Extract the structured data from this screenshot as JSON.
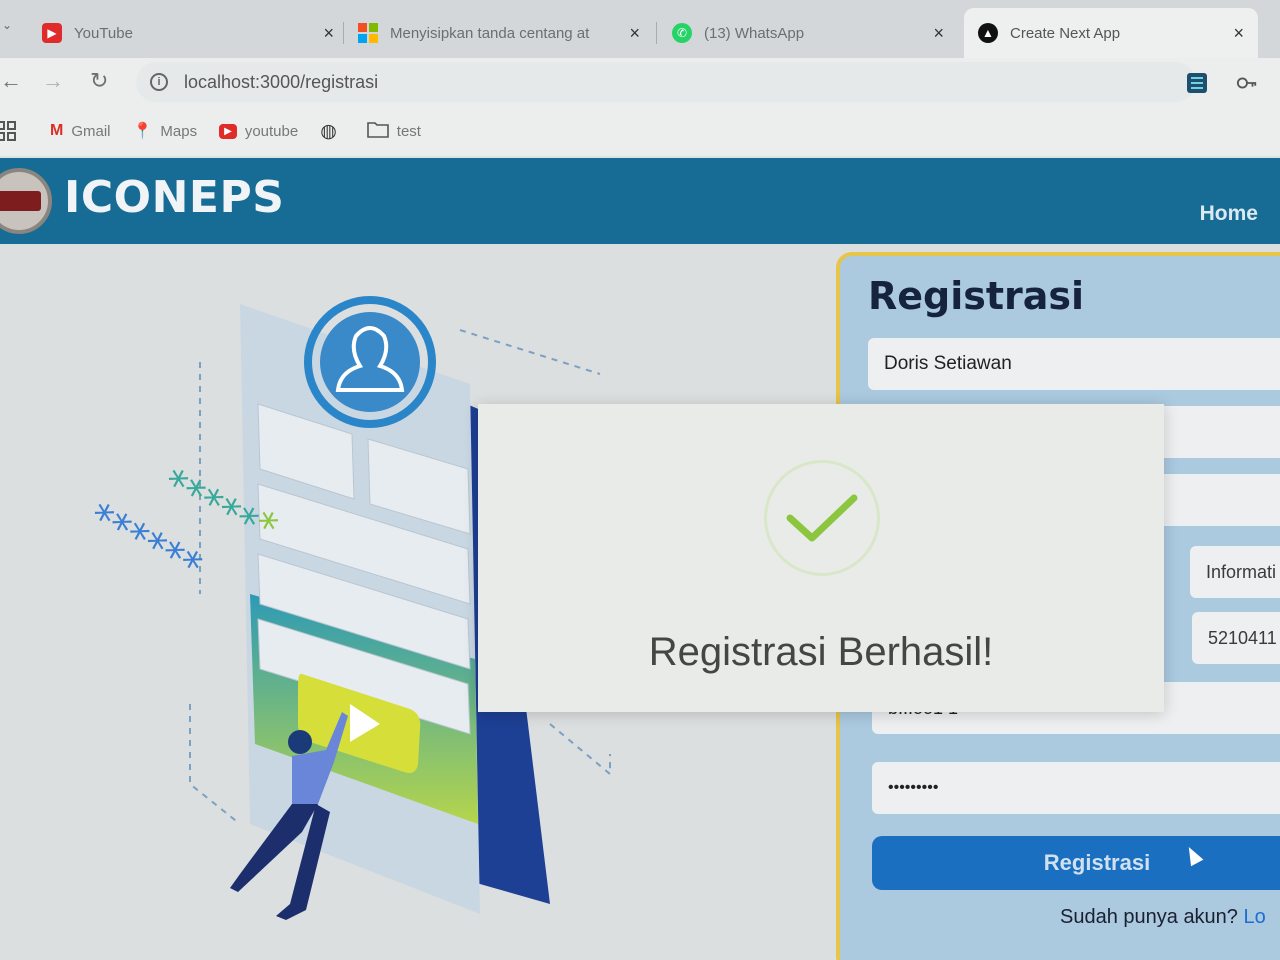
{
  "browser": {
    "tabs": [
      {
        "title": "YouTube",
        "icon": "youtube-icon",
        "close": "×"
      },
      {
        "title": "Menyisipkan tanda centang at",
        "icon": "microsoft-icon",
        "close": "×"
      },
      {
        "title": "(13) WhatsApp",
        "icon": "whatsapp-icon",
        "close": "×"
      },
      {
        "title": "Create Next App",
        "icon": "nextjs-icon",
        "close": "×"
      }
    ],
    "url": "localhost:3000/registrasi",
    "bookmarks": [
      {
        "label": "Gmail",
        "icon": "gmail-icon"
      },
      {
        "label": "Maps",
        "icon": "maps-icon"
      },
      {
        "label": "youtube",
        "icon": "youtube-icon"
      },
      {
        "label": "",
        "icon": "globe-icon"
      },
      {
        "label": "test",
        "icon": "folder-icon"
      }
    ]
  },
  "header": {
    "brand": "ICONEPS",
    "nav_home": "Home"
  },
  "form": {
    "title": "Registrasi",
    "name_value": "Doris Setiawan",
    "program_value": "Informati",
    "nim_value": "5210411",
    "username_partial": "b...oo1 1",
    "password_value": "•••••••••",
    "submit_label": "Registrasi",
    "login_prompt": "Sudah punya akun?",
    "login_link": "Lo"
  },
  "modal": {
    "message": "Registrasi Berhasil!",
    "icon": "check-icon"
  },
  "colors": {
    "header_bg": "#176c96",
    "card_bg": "#abc9df",
    "card_border": "#e7c44a",
    "button": "#1a6fc1",
    "check": "#8cc63f"
  }
}
